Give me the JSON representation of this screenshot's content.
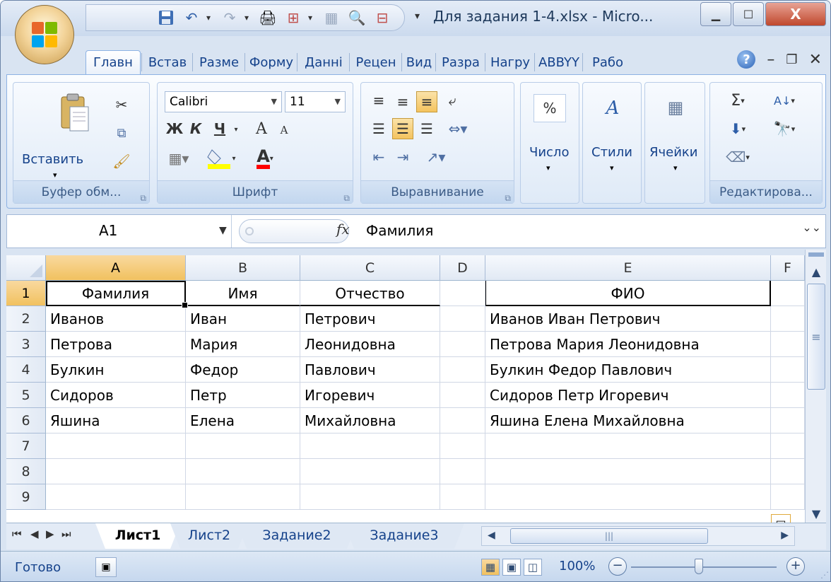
{
  "window": {
    "title": "Для задания 1-4.xlsx - Micro...",
    "controls": {
      "minimize": "▁",
      "maximize": "☐",
      "close": "X"
    }
  },
  "ribbon_tabs": [
    "Главн",
    "Встав",
    "Разме",
    "Форму",
    "Данні",
    "Рецен",
    "Вид",
    "Разра",
    "Нагру",
    "ABBYY",
    "Рабо"
  ],
  "ribbon_tabs_active_index": 0,
  "ribbon": {
    "clipboard": {
      "paste_label": "Вставить",
      "group_label": "Буфер обм..."
    },
    "font": {
      "font_name": "Calibri",
      "font_size": "11",
      "bold": "Ж",
      "italic": "К",
      "underline": "Ч",
      "grow": "A",
      "shrink": "A",
      "font_color_letter": "A",
      "group_label": "Шрифт"
    },
    "alignment": {
      "group_label": "Выравнивание"
    },
    "number": {
      "label": "Число",
      "icon_text": "%"
    },
    "styles": {
      "label": "Стили"
    },
    "cells": {
      "label": "Ячейки"
    },
    "editing": {
      "group_label": "Редактирова..."
    }
  },
  "formula_bar": {
    "name_box": "A1",
    "fx": "fx",
    "value": "Фамилия"
  },
  "columns": [
    "A",
    "B",
    "C",
    "D",
    "E",
    "F"
  ],
  "rows": [
    {
      "num": "1",
      "cells": [
        "Фамилия",
        "Имя",
        "Отчество",
        "",
        "ФИО",
        ""
      ]
    },
    {
      "num": "2",
      "cells": [
        "Иванов",
        "Иван",
        "Петрович",
        "",
        "Иванов Иван Петрович",
        ""
      ]
    },
    {
      "num": "3",
      "cells": [
        "Петрова",
        "Мария",
        "Леонидовна",
        "",
        "Петрова Мария Леонидовна",
        ""
      ]
    },
    {
      "num": "4",
      "cells": [
        "Булкин",
        "Федор",
        "Павлович",
        "",
        "Булкин Федор Павлович",
        ""
      ]
    },
    {
      "num": "5",
      "cells": [
        "Сидоров",
        "Петр",
        "Игоревич",
        "",
        "Сидоров Петр Игоревич",
        ""
      ]
    },
    {
      "num": "6",
      "cells": [
        "Яшина",
        "Елена",
        "Михайловна",
        "",
        "Яшина Елена Михайловна",
        ""
      ]
    },
    {
      "num": "7",
      "cells": [
        "",
        "",
        "",
        "",
        "",
        ""
      ]
    },
    {
      "num": "8",
      "cells": [
        "",
        "",
        "",
        "",
        "",
        ""
      ]
    },
    {
      "num": "9",
      "cells": [
        "",
        "",
        "",
        "",
        "",
        ""
      ]
    }
  ],
  "sheets": [
    "Лист1",
    "Лист2",
    "Задание2",
    "Задание3"
  ],
  "status": {
    "ready": "Готово",
    "zoom": "100%",
    "zoom_fraction": 0.5
  }
}
